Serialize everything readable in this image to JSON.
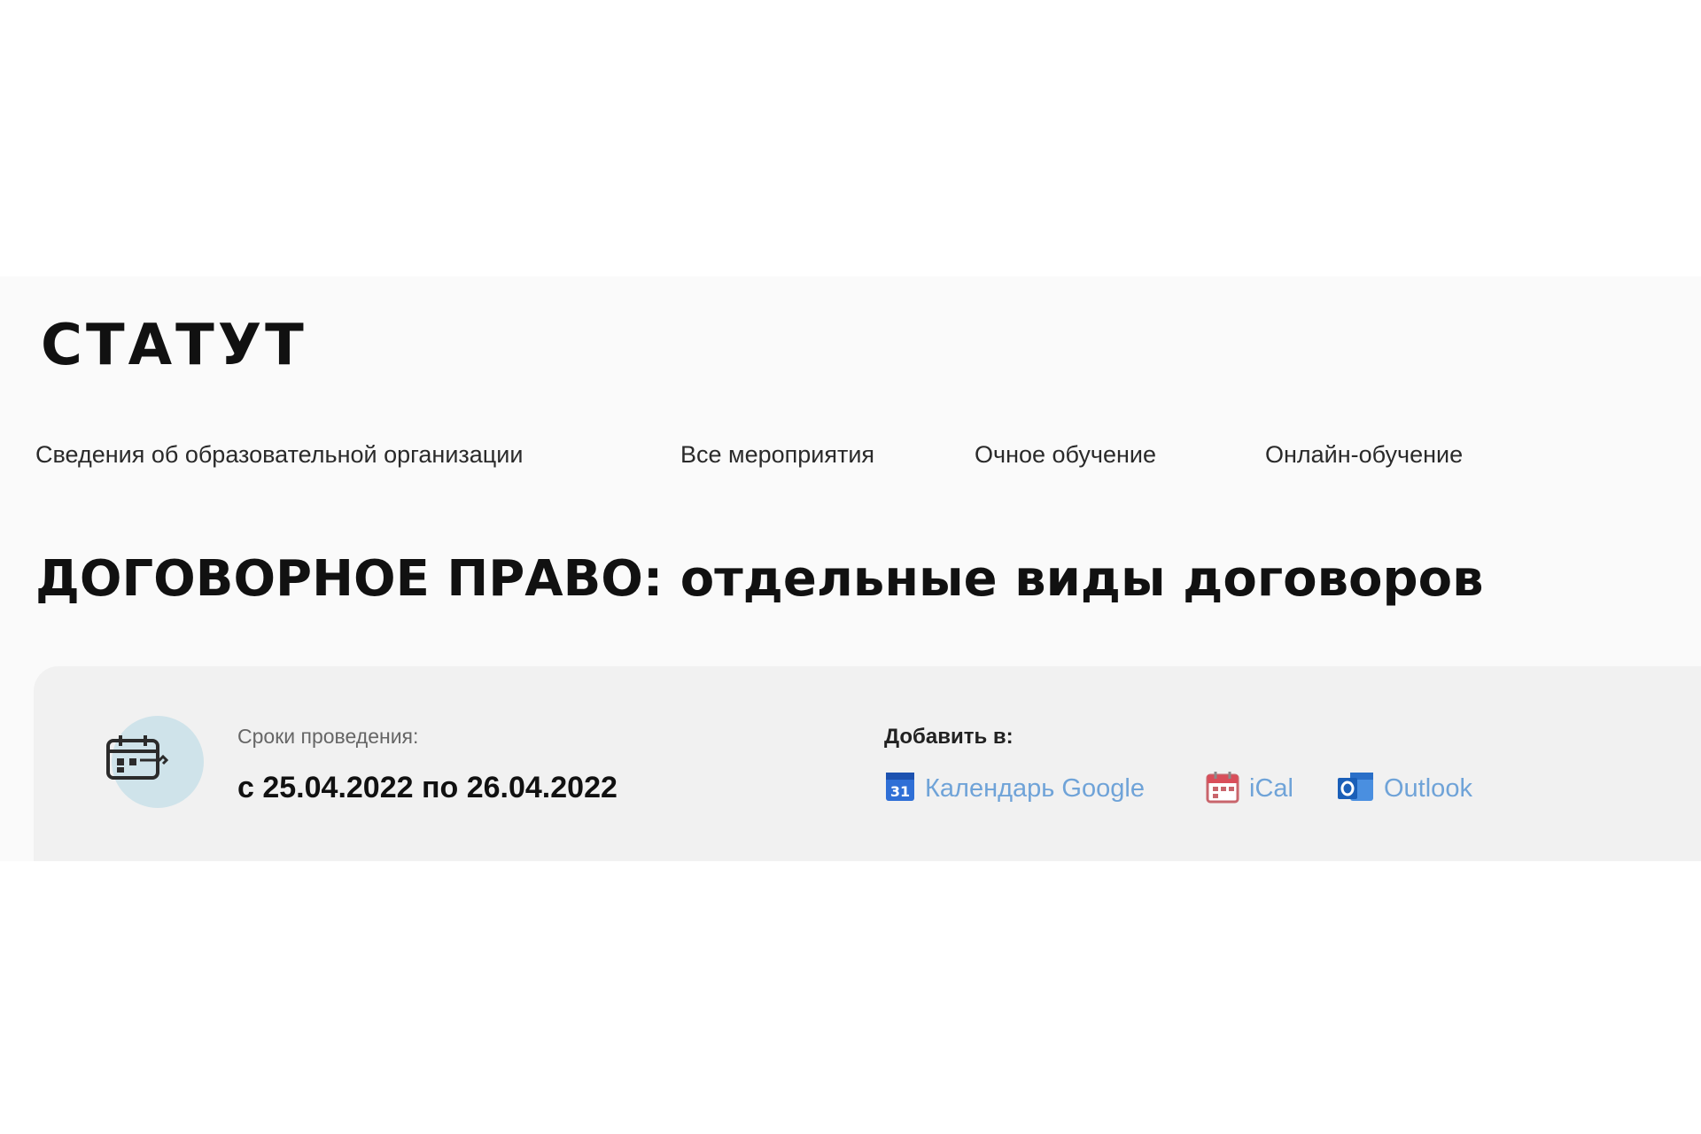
{
  "header": {
    "logo_text": "СТАТУТ"
  },
  "nav": {
    "items": [
      {
        "label": "Сведения об образовательной организации"
      },
      {
        "label": "Все мероприятия"
      },
      {
        "label": "Очное обучение"
      },
      {
        "label": "Онлайн-обучение"
      }
    ]
  },
  "event": {
    "title": "ДОГОВОРНОЕ ПРАВО: отдельные виды договоров",
    "dates_label": "Сроки проведения:",
    "dates_value": "с 25.04.2022 по 26.04.2022",
    "add_to_label": "Добавить в:",
    "calendars": [
      {
        "label": "Календарь Google",
        "icon": "google-calendar-icon"
      },
      {
        "label": "iCal",
        "icon": "ical-icon"
      },
      {
        "label": "Outlook",
        "icon": "outlook-icon"
      }
    ]
  },
  "colors": {
    "accent_circle": "#cfe3ea",
    "link": "#6fa3d8",
    "card_bg": "#f1f1f1"
  }
}
